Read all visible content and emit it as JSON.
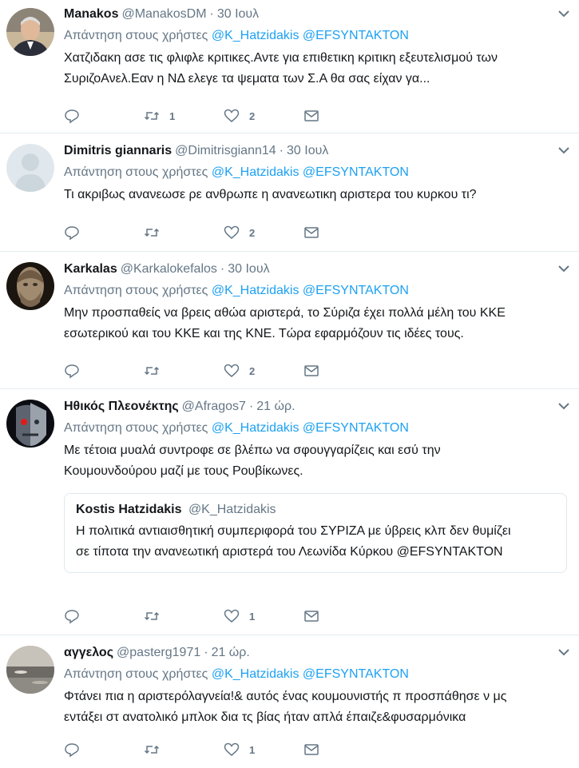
{
  "reply_prefix": "Απάντηση στους χρήστες",
  "tweets": [
    {
      "name": "Manakos",
      "handle": "@ManakosDM",
      "time": "30 Ιουλ",
      "mentions": [
        "@K_Hatzidakis",
        "@EFSYNTAKTON"
      ],
      "text_lines": [
        "Χατζιδακη ασε τις φλιφλε κριτικες.Αντε για επιθετικη κριτικη εξευτελισμού των",
        "ΣυριζοΑνελ.Εαν η ΝΔ ελεγε τα ψεματα των Σ.Α θα σας είχαν γα..."
      ],
      "retweets": "1",
      "likes": "2"
    },
    {
      "name": "Dimitris giannaris",
      "handle": "@Dimitrisgiann14",
      "time": "30 Ιουλ",
      "mentions": [
        "@K_Hatzidakis",
        "@EFSYNTAKTON"
      ],
      "text_lines": [
        "Τι ακριβως ανανεωσε ρε ανθρωπε η ανανεωτικη αριστερα του κυρκου τι?"
      ],
      "retweets": "",
      "likes": "2"
    },
    {
      "name": "Karkalas",
      "handle": "@Karkalokefalos",
      "time": "30 Ιουλ",
      "mentions": [
        "@K_Hatzidakis",
        "@EFSYNTAKTON"
      ],
      "text_lines": [
        "Μην προσπαθείς να βρεις αθώα αριστερά, το Σύριζα έχει πολλά μέλη του ΚΚΕ",
        "εσωτερικού και του ΚΚΕ και της ΚΝΕ. Τώρα εφαρμόζουν τις ιδέες τους."
      ],
      "retweets": "",
      "likes": "2"
    },
    {
      "name": "Ηθικός Πλεονέκτης",
      "handle": "@Afragos7",
      "time": "21 ώρ.",
      "mentions": [
        "@K_Hatzidakis",
        "@EFSYNTAKTON"
      ],
      "text_lines": [
        "Με τέτοια μυαλά συντροφε σε βλέπω να σφουγγαρίζεις και εσύ την",
        "Κουμουνδούρου μαζί με τους Ρουβίκωνες."
      ],
      "quote": {
        "name": "Kostis Hatzidakis",
        "handle": "@K_Hatzidakis",
        "text_lines": [
          "Η πολιτικά αντιαισθητική συμπεριφορά του ΣΥΡΙΖΑ  με ύβρεις κλπ δεν θυμίζει",
          "σε τίποτα την ανανεωτική αριστερά του Λεωνίδα Κύρκου @EFSYNTAKTON"
        ]
      },
      "retweets": "",
      "likes": "1"
    },
    {
      "name": "αγγελος",
      "handle": "@pasterg1971",
      "time": "21 ώρ.",
      "mentions": [
        "@K_Hatzidakis",
        "@EFSYNTAKTON"
      ],
      "text_lines": [
        "Φτάνει πια η αριστερόλαγνεία!& αυτός ένας κουμουνιστής π προσπάθησε ν μς",
        "εντάξει στ ανατολικό μπλοκ δια τς βίας ήταν απλά έπαιζε&φυσαρμόνικα"
      ],
      "retweets": "",
      "likes": "1"
    }
  ],
  "separator": "·",
  "colors": {
    "link": "#1da1f2",
    "muted": "#657786",
    "text": "#14171a",
    "border": "#e6ecf0"
  },
  "icons": [
    "reply-icon",
    "retweet-icon",
    "like-icon",
    "dm-icon",
    "caret-down-icon"
  ]
}
